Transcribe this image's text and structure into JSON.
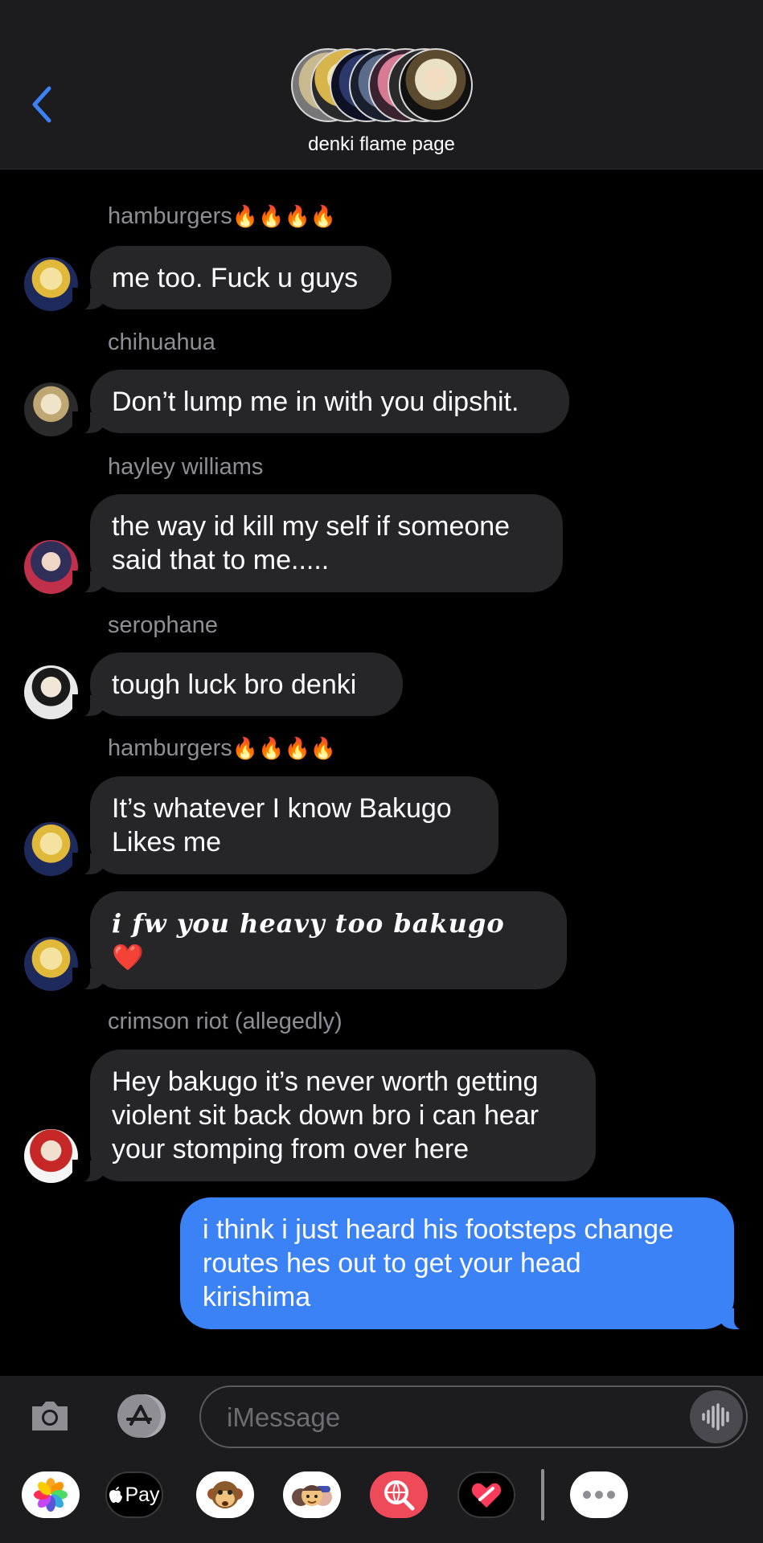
{
  "header": {
    "back_icon": "chevron-left-icon",
    "group_name": "denki flame page",
    "accent_color": "#3b82f6"
  },
  "messages": [
    {
      "sender": "hamburgers",
      "sender_emoji": "🔥🔥🔥🔥",
      "lines": [
        "me too. Fuck u guys"
      ]
    },
    {
      "sender": "chihuahua",
      "lines": [
        "Don’t lump me in with you dipshit."
      ]
    },
    {
      "sender": "hayley williams",
      "lines": [
        "the way id kill my self if someone",
        "said that to me....."
      ]
    },
    {
      "sender": "serophane",
      "lines": [
        "tough luck bro denki"
      ]
    },
    {
      "sender": "hamburgers",
      "sender_emoji": "🔥🔥🔥🔥",
      "lines": [
        "It’s whatever I know Bakugo",
        "Likes me"
      ]
    },
    {
      "lines": [
        "i fw you heavy too bakugo"
      ],
      "emoji": "❤️"
    },
    {
      "sender": "crimson riot (allegedly)",
      "lines": [
        "Hey bakugo it’s never worth getting",
        "violent sit back down bro i can hear",
        "your stomping from over here"
      ]
    }
  ],
  "my_message": {
    "lines": [
      "i think i just heard his footsteps change",
      "routes hes out to get your head",
      "kirishima"
    ],
    "color": "#3b82f6"
  },
  "input": {
    "placeholder": "iMessage",
    "camera_icon": "camera-icon",
    "apps_icon": "app-store-icon",
    "mic_icon": "audio-waveform-icon"
  },
  "tray": {
    "apple_pay_label": "Pay",
    "items": [
      "photos-icon",
      "apple-pay-icon",
      "animoji-icon",
      "memoji-icon",
      "web-search-icon",
      "digital-touch-icon",
      "more-icon"
    ]
  }
}
